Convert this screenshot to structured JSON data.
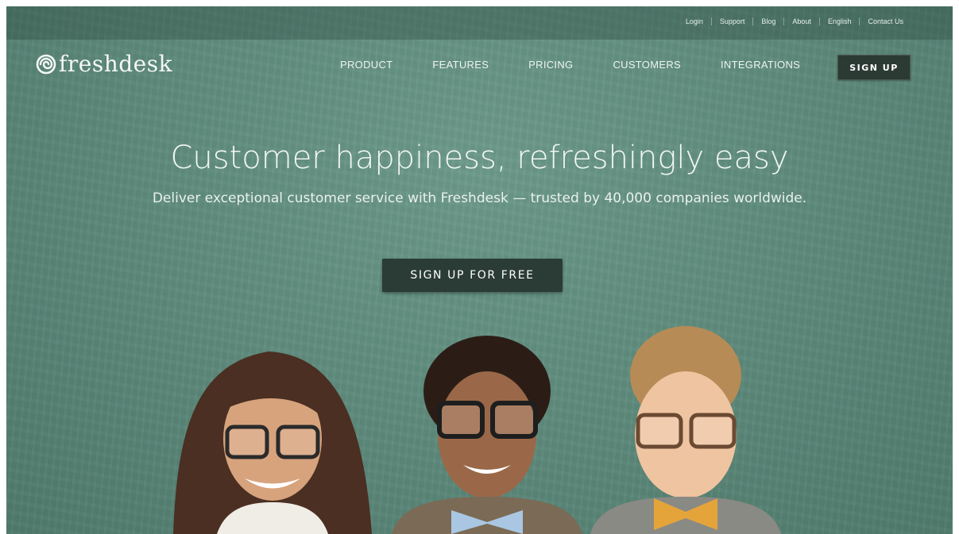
{
  "utility_links": [
    "Login",
    "Support",
    "Blog",
    "About",
    "English",
    "Contact Us"
  ],
  "logo": {
    "text": "freshdesk",
    "icon": "freshdesk-swirl-icon"
  },
  "nav": {
    "items": [
      "PRODUCT",
      "FEATURES",
      "PRICING",
      "CUSTOMERS",
      "INTEGRATIONS"
    ],
    "signup_label": "SIGN UP"
  },
  "hero": {
    "title": "Customer happiness, refreshingly easy",
    "subtitle": "Deliver exceptional customer service with Freshdesk — trusted by 40,000 companies worldwide.",
    "cta_label": "SIGN UP FOR FREE"
  },
  "colors": {
    "chalkboard": "#5f8c7d",
    "button_dark": "#2a3c35",
    "text_light": "#f1f6f3"
  },
  "image": {
    "subject": "three-children-with-glasses-and-bow-ties"
  }
}
